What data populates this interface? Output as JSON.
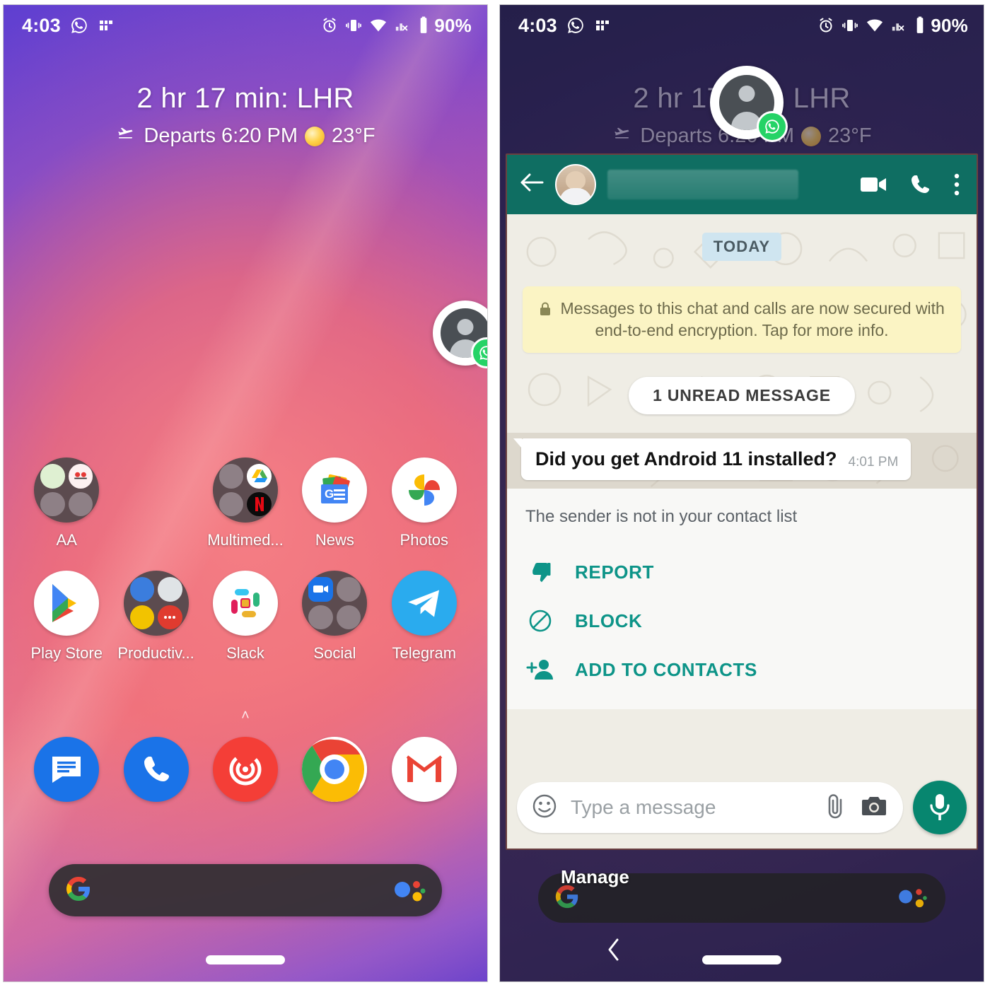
{
  "left_phone": {
    "status_bar": {
      "time": "4:03",
      "icons": [
        "whatsapp-status-icon",
        "fi-network-icon",
        "alarm-icon",
        "vibrate-icon",
        "wifi-icon",
        "cellular-no-sim-icon"
      ],
      "battery": "90%"
    },
    "at_a_glance": {
      "title": "2 hr 17 min: LHR",
      "departs": "Departs 6:20 PM",
      "temperature": "23°F"
    },
    "chat_head": {
      "badge": "whatsapp-icon",
      "avatar": "generic-contact-avatar"
    },
    "app_rows": [
      [
        {
          "label": "AA",
          "icon": "folder-aa"
        },
        {
          "label": "",
          "icon": "empty-slot"
        },
        {
          "label": "Multimed...",
          "icon": "folder-multimedia"
        },
        {
          "label": "News",
          "icon": "google-news-icon"
        },
        {
          "label": "Photos",
          "icon": "google-photos-icon"
        }
      ],
      [
        {
          "label": "Play Store",
          "icon": "google-play-icon"
        },
        {
          "label": "Productiv...",
          "icon": "folder-productivity"
        },
        {
          "label": "Slack",
          "icon": "slack-icon"
        },
        {
          "label": "Social",
          "icon": "folder-social"
        },
        {
          "label": "Telegram",
          "icon": "telegram-icon"
        }
      ]
    ],
    "drawer_caret": "˄",
    "dock": [
      {
        "label": "Messages",
        "icon": "google-messages-icon"
      },
      {
        "label": "Phone",
        "icon": "phone-dialer-icon"
      },
      {
        "label": "Pocket Casts",
        "icon": "pocket-casts-icon"
      },
      {
        "label": "Chrome",
        "icon": "chrome-icon"
      },
      {
        "label": "Gmail",
        "icon": "gmail-icon"
      }
    ],
    "search_bar": {
      "logo": "google-g-icon",
      "assistant": "google-assistant-icon",
      "value": ""
    }
  },
  "right_phone": {
    "status_bar": {
      "time": "4:03",
      "battery": "90%"
    },
    "at_a_glance": {
      "title": "2 hr 17 min: LHR",
      "departs": "Departs 6:20 PM",
      "temperature": "23°F"
    },
    "whatsapp": {
      "header": {
        "back": "back-arrow-icon",
        "contact_name_hidden": "",
        "video_call": "video-call-icon",
        "voice_call": "phone-call-icon",
        "overflow": "more-vert-icon"
      },
      "date_chip": "TODAY",
      "encryption_notice": "Messages to this chat and calls are now secured with end-to-end encryption. Tap for more info.",
      "unread_chip": "1 UNREAD MESSAGE",
      "message": {
        "text": "Did you get Android 11 installed?",
        "time": "4:01 PM"
      },
      "sender_panel": {
        "note": "The sender is not in your contact list",
        "actions": [
          {
            "label": "REPORT",
            "icon": "thumb-down-icon"
          },
          {
            "label": "BLOCK",
            "icon": "block-circle-icon"
          },
          {
            "label": "ADD TO CONTACTS",
            "icon": "person-add-icon"
          }
        ]
      },
      "input_bar": {
        "emoji": "emoji-smiley-icon",
        "placeholder": "Type a message",
        "value": "",
        "attach": "paperclip-icon",
        "camera": "camera-icon",
        "mic": "microphone-icon"
      }
    },
    "bubble_manage_label": "Manage",
    "nav_bar": {
      "back": "back-chevron-icon",
      "home_pill": "gesture-home-pill"
    }
  },
  "colors": {
    "whatsapp_header_green": "#0f6e62",
    "whatsapp_accent_teal": "#0d9488",
    "whatsapp_bubble_green": "#25d366",
    "chat_wallpaper": "#EFEDE5",
    "encryption_note_yellow": "#FBF4C4",
    "today_chip_blue": "#CFE5F0"
  }
}
